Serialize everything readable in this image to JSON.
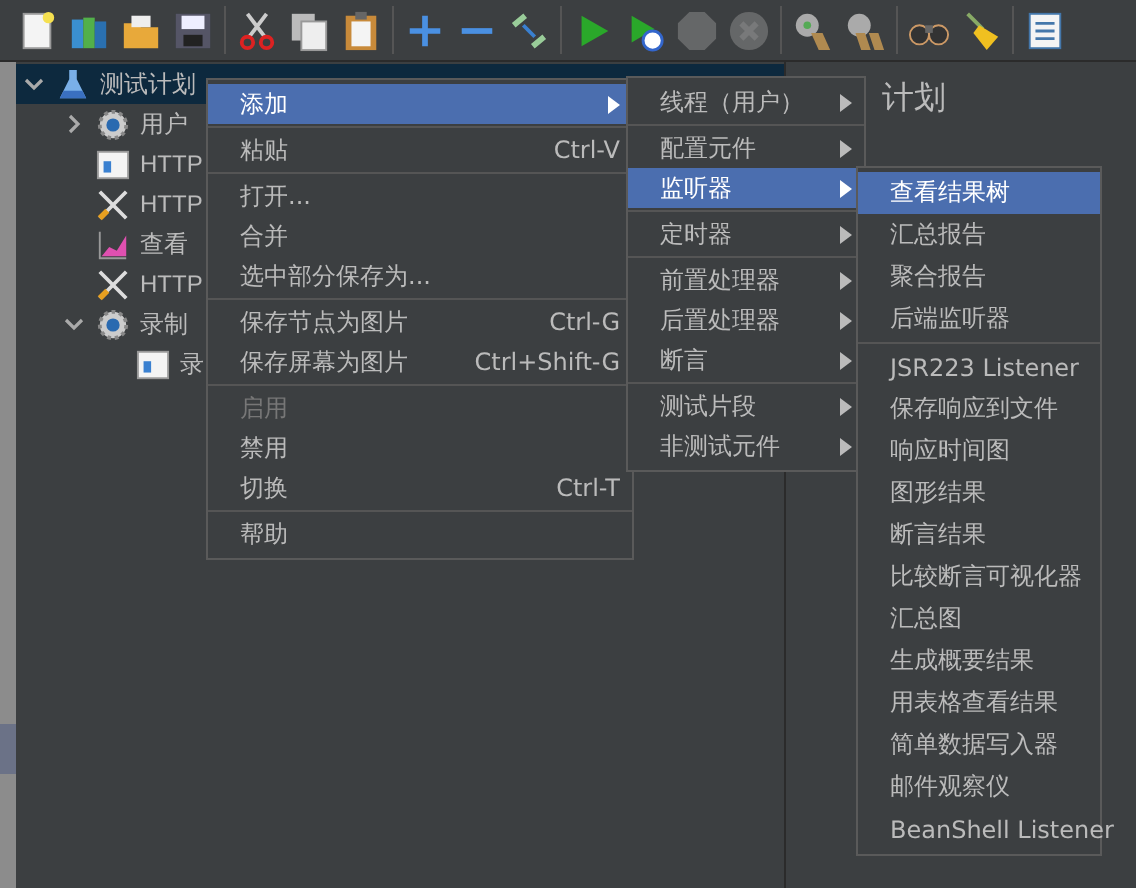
{
  "toolbar": [
    {
      "kind": "new",
      "disabled": false
    },
    {
      "kind": "templates",
      "disabled": false
    },
    {
      "kind": "open",
      "disabled": false
    },
    {
      "kind": "save",
      "disabled": false
    },
    {
      "kind": "cut",
      "disabled": false
    },
    {
      "kind": "copy",
      "disabled": false
    },
    {
      "kind": "paste",
      "disabled": false
    },
    {
      "kind": "expand",
      "disabled": false
    },
    {
      "kind": "collapse",
      "disabled": false
    },
    {
      "kind": "toggle",
      "disabled": false
    },
    {
      "kind": "start",
      "disabled": false
    },
    {
      "kind": "start-no-timer",
      "disabled": false
    },
    {
      "kind": "stop",
      "disabled": true
    },
    {
      "kind": "shutdown",
      "disabled": true
    },
    {
      "kind": "clear",
      "disabled": false
    },
    {
      "kind": "clear-all",
      "disabled": false
    },
    {
      "kind": "search",
      "disabled": false
    },
    {
      "kind": "reset-search",
      "disabled": false
    },
    {
      "kind": "log",
      "disabled": false
    }
  ],
  "tree": [
    {
      "label": "测试计划",
      "kind": "plan",
      "expanded": true,
      "selected": true,
      "children": [
        {
          "label": "用户",
          "kind": "gear",
          "expanded": false,
          "selected": false
        },
        {
          "label": "HTTP",
          "kind": "config",
          "selected": false
        },
        {
          "label": "HTTP",
          "kind": "tool",
          "selected": false
        },
        {
          "label": "查看",
          "kind": "chart",
          "selected": false
        },
        {
          "label": "HTTP",
          "kind": "tool",
          "selected": false
        },
        {
          "label": "录制",
          "kind": "gear",
          "expanded": true,
          "selected": false,
          "children": [
            {
              "label": "录",
              "kind": "config",
              "selected": false
            }
          ]
        }
      ]
    }
  ],
  "panel": {
    "title": "计划"
  },
  "menus": [
    {
      "groups": [
        [
          {
            "label": "添加",
            "submenu": true,
            "selected": true,
            "disabled": false
          }
        ],
        [
          {
            "label": "粘贴",
            "shortcut": "Ctrl-V",
            "submenu": false,
            "selected": false,
            "disabled": false
          }
        ],
        [
          {
            "label": "打开...",
            "submenu": false,
            "selected": false,
            "disabled": false
          },
          {
            "label": "合并",
            "submenu": false,
            "selected": false,
            "disabled": false
          },
          {
            "label": "选中部分保存为...",
            "submenu": false,
            "selected": false,
            "disabled": false
          }
        ],
        [
          {
            "label": "保存节点为图片",
            "shortcut": "Ctrl-G",
            "submenu": false,
            "selected": false,
            "disabled": false
          },
          {
            "label": "保存屏幕为图片",
            "shortcut": "Ctrl+Shift-G",
            "submenu": false,
            "selected": false,
            "disabled": false
          }
        ],
        [
          {
            "label": "启用",
            "submenu": false,
            "selected": false,
            "disabled": true
          },
          {
            "label": "禁用",
            "submenu": false,
            "selected": false,
            "disabled": false
          },
          {
            "label": "切换",
            "shortcut": "Ctrl-T",
            "submenu": false,
            "selected": false,
            "disabled": false
          }
        ],
        [
          {
            "label": "帮助",
            "submenu": false,
            "selected": false,
            "disabled": false
          }
        ]
      ]
    },
    {
      "groups": [
        [
          {
            "label": "线程（用户）",
            "submenu": true,
            "selected": false
          }
        ],
        [
          {
            "label": "配置元件",
            "submenu": true,
            "selected": false
          },
          {
            "label": "监听器",
            "submenu": true,
            "selected": true
          }
        ],
        [
          {
            "label": "定时器",
            "submenu": true,
            "selected": false
          }
        ],
        [
          {
            "label": "前置处理器",
            "submenu": true,
            "selected": false
          },
          {
            "label": "后置处理器",
            "submenu": true,
            "selected": false
          },
          {
            "label": "断言",
            "submenu": true,
            "selected": false
          }
        ],
        [
          {
            "label": "测试片段",
            "submenu": true,
            "selected": false
          },
          {
            "label": "非测试元件",
            "submenu": true,
            "selected": false
          }
        ]
      ]
    },
    {
      "groups": [
        [
          {
            "label": "查看结果树",
            "selected": true
          },
          {
            "label": "汇总报告",
            "selected": false
          },
          {
            "label": "聚合报告",
            "selected": false
          },
          {
            "label": "后端监听器",
            "selected": false
          }
        ],
        [
          {
            "label": "JSR223 Listener",
            "selected": false
          },
          {
            "label": "保存响应到文件",
            "selected": false
          },
          {
            "label": "响应时间图",
            "selected": false
          },
          {
            "label": "图形结果",
            "selected": false
          },
          {
            "label": "断言结果",
            "selected": false
          },
          {
            "label": "比较断言可视化器",
            "selected": false
          },
          {
            "label": "汇总图",
            "selected": false
          },
          {
            "label": "生成概要结果",
            "selected": false
          },
          {
            "label": "用表格查看结果",
            "selected": false
          },
          {
            "label": "简单数据写入器",
            "selected": false
          },
          {
            "label": "邮件观察仪",
            "selected": false
          },
          {
            "label": "BeanShell Listener",
            "selected": false
          }
        ]
      ]
    }
  ]
}
